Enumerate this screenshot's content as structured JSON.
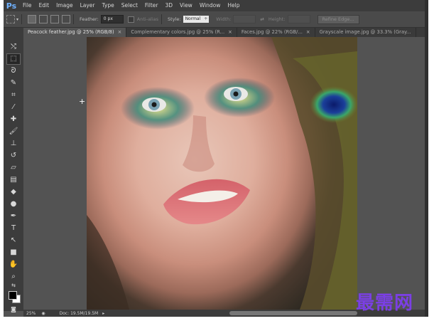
{
  "app": {
    "logo": "Ps"
  },
  "menu": [
    "File",
    "Edit",
    "Image",
    "Layer",
    "Type",
    "Select",
    "Filter",
    "3D",
    "View",
    "Window",
    "Help"
  ],
  "options": {
    "feather_label": "Feather:",
    "feather_value": "0 px",
    "antialias_label": "Anti-alias",
    "style_label": "Style:",
    "style_value": "Normal",
    "width_label": "Width:",
    "height_label": "Height:",
    "refine_label": "Refine Edge..."
  },
  "tabs": [
    {
      "label": "Peacock feather.jpg @ 25% (RGB/8)",
      "active": true
    },
    {
      "label": "Complementary colors.jpg @ 25% (R...",
      "active": false
    },
    {
      "label": "Faces.jpg @ 22% (RGB/...",
      "active": false
    },
    {
      "label": "Grayscale image.jpg @ 33.3% (Gray...",
      "active": false
    }
  ],
  "tab_close": "×",
  "tools": [
    "move-tool-icon",
    "marquee-tool-icon",
    "lasso-tool-icon",
    "magic-wand-icon",
    "crop-tool-icon",
    "eyedropper-icon",
    "healing-brush-icon",
    "brush-tool-icon",
    "clone-stamp-icon",
    "history-brush-icon",
    "eraser-icon",
    "gradient-tool-icon",
    "blur-tool-icon",
    "dodge-tool-icon",
    "pen-tool-icon",
    "type-tool-icon",
    "path-selection-icon",
    "shape-tool-icon",
    "hand-tool-icon",
    "zoom-tool-icon"
  ],
  "status": {
    "zoom": "25%",
    "doc": "Doc: 19.5M/19.5M"
  },
  "watermark": "最需网"
}
